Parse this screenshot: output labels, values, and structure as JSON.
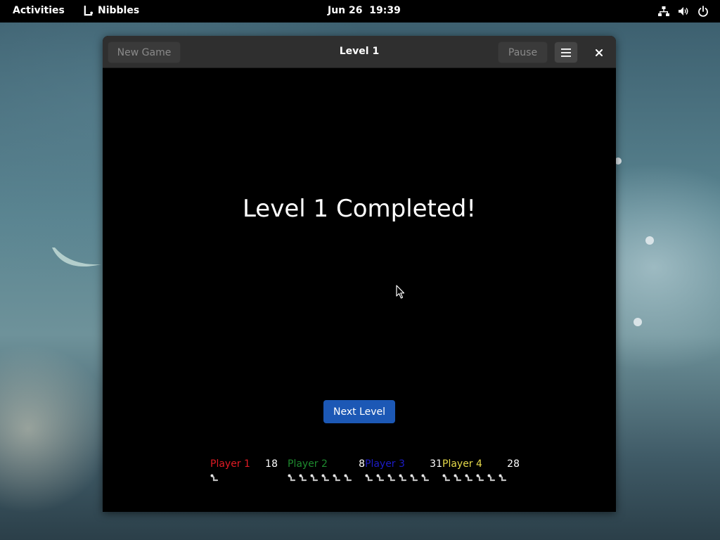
{
  "topbar": {
    "activities": "Activities",
    "app_name": "Nibbles",
    "clock": "Jun 26  19:39",
    "tray_icons": [
      "network-icon",
      "volume-icon",
      "power-icon"
    ]
  },
  "window": {
    "title": "Level 1",
    "new_game_label": "New Game",
    "pause_label": "Pause",
    "menu_icon": "hamburger-menu-icon",
    "close_icon": "close-icon"
  },
  "game": {
    "message": "Level 1 Completed!",
    "next_level_label": "Next Level",
    "players": [
      {
        "name": "Player 1",
        "score": "18",
        "color": "#e01b24",
        "lives": 1
      },
      {
        "name": "Player 2",
        "score": "8",
        "color": "#1e8a2e",
        "lives": 6
      },
      {
        "name": "Player 3",
        "score": "31",
        "color": "#1c1cc8",
        "lives": 6
      },
      {
        "name": "Player 4",
        "score": "28",
        "color": "#e5d94a",
        "lives": 6
      }
    ]
  },
  "colors": {
    "accent_button": "#1c58b5",
    "topbar_bg": "#000000",
    "headerbar_bg": "#2f2f2f"
  }
}
